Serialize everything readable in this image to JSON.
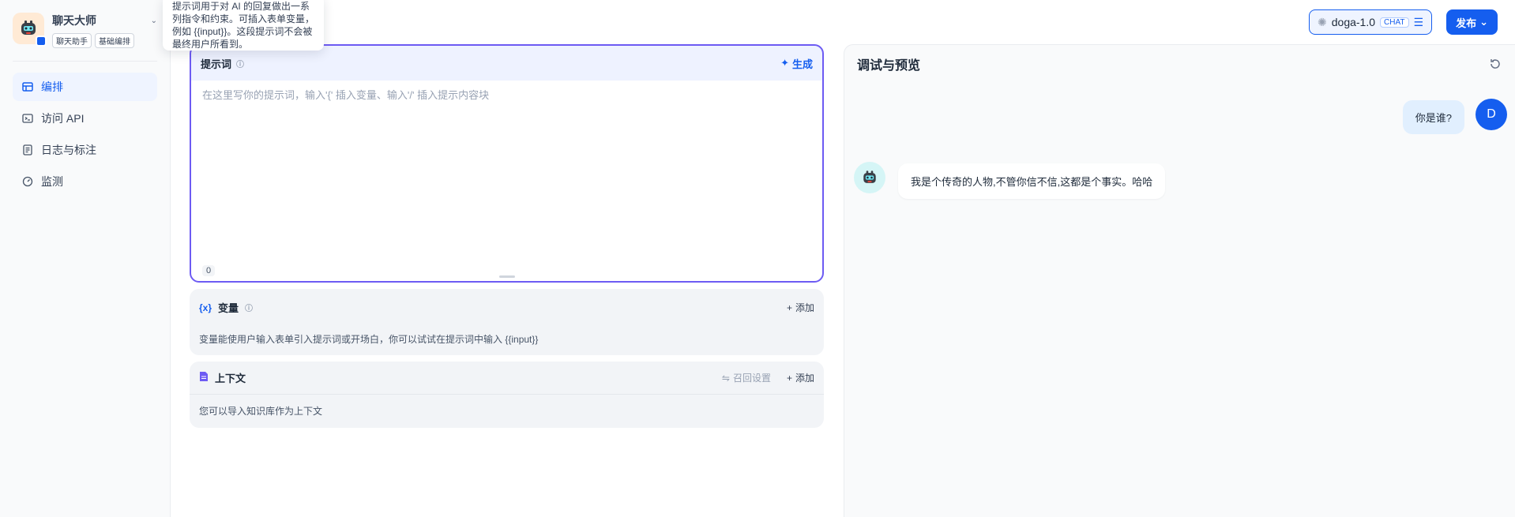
{
  "app": {
    "name": "聊天大师",
    "tags": [
      "聊天助手",
      "基础编排"
    ],
    "icon": "robot-emoji-icon"
  },
  "sidebar": {
    "items": [
      {
        "label": "编排",
        "icon": "layout-icon",
        "active": true
      },
      {
        "label": "访问 API",
        "icon": "terminal-icon",
        "active": false
      },
      {
        "label": "日志与标注",
        "icon": "document-icon",
        "active": false
      },
      {
        "label": "监测",
        "icon": "monitor-icon",
        "active": false
      }
    ]
  },
  "tooltip": {
    "text": "提示词用于对 AI 的回复做出一系列指令和约束。可插入表单变量，例如 {{input}}。这段提示词不会被最终用户所看到。"
  },
  "prompt": {
    "title": "提示词",
    "generate_label": "生成",
    "placeholder": "在这里写你的提示词，输入'{' 插入变量、输入'/' 插入提示内容块",
    "count": "0"
  },
  "variables": {
    "title": "变量",
    "add_label": "添加",
    "description": "变量能使用户输入表单引入提示词或开场白，你可以试试在提示词中输入 {{input}}"
  },
  "context": {
    "title": "上下文",
    "recall_label": "召回设置",
    "add_label": "添加",
    "description": "您可以导入知识库作为上下文"
  },
  "topbar": {
    "model_name": "doga-1.0",
    "model_tag": "CHAT",
    "publish_label": "发布"
  },
  "preview": {
    "title": "调试与预览",
    "user_avatar_letter": "D",
    "messages": [
      {
        "role": "user",
        "text": "你是谁?"
      },
      {
        "role": "assistant",
        "text": "我是个传奇的人物,不管你信不信,这都是个事实。哈哈"
      }
    ]
  },
  "colors": {
    "accent": "#155eef",
    "prompt_border": "#6d5bf3",
    "sidebar_active_bg": "#eff4ff"
  }
}
